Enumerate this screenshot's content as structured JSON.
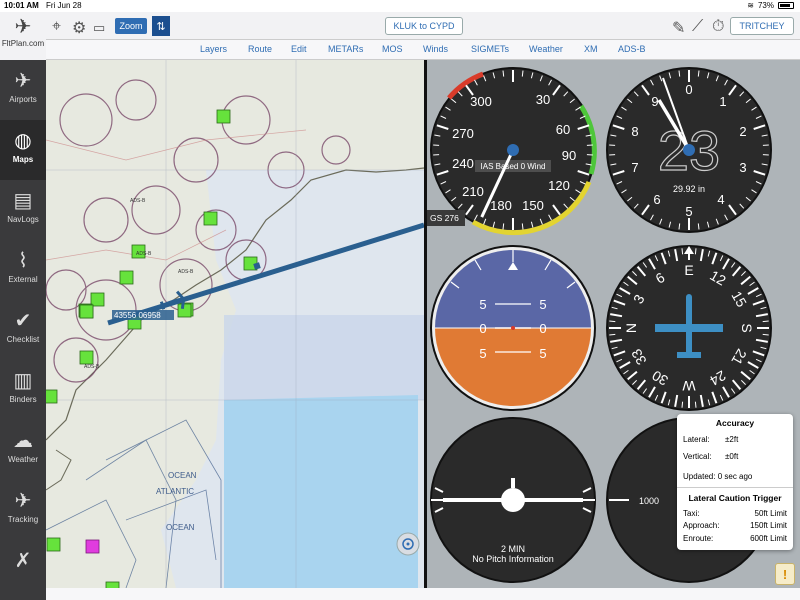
{
  "status": {
    "time": "10:01 AM",
    "date": "Fri Jun 28",
    "battery": "73%"
  },
  "toolbar": {
    "logo_text": "FltPlan.com",
    "zoom_label": "Zoom",
    "swap_label": "⇅",
    "route_label": "KLUK to CYPD",
    "user_label": "TRITCHEY"
  },
  "menu": [
    "Layers",
    "Route",
    "Edit",
    "METARs",
    "MOS",
    "Winds",
    "SIGMETs",
    "Weather",
    "XM",
    "ADS-B"
  ],
  "sidebar": [
    {
      "label": "Airports",
      "icon": "airport-icon"
    },
    {
      "label": "Maps",
      "icon": "globe-icon",
      "active": true
    },
    {
      "label": "NavLogs",
      "icon": "navlog-icon"
    },
    {
      "label": "External",
      "icon": "antenna-icon"
    },
    {
      "label": "Checklist",
      "icon": "check-icon"
    },
    {
      "label": "Binders",
      "icon": "binder-icon"
    },
    {
      "label": "Weather",
      "icon": "cloud-icon"
    },
    {
      "label": "Tracking",
      "icon": "plane-track-icon"
    },
    {
      "label": "",
      "icon": "tools-icon"
    }
  ],
  "map": {
    "ocean_label": "ATLANTIC",
    "ocean_label2": "OCEAN",
    "ocean_label3": "OCEAN",
    "aircraft_tag": "43556 06958",
    "gs_label": "GS 276",
    "adsb_labels": [
      "ADS-B",
      "ADS-B",
      "ADS-B",
      "ADS-B"
    ],
    "location_icon": "crosshair-icon"
  },
  "instruments": {
    "airspeed": {
      "ticks": [
        "300",
        "30",
        "60",
        "90",
        "120",
        "150",
        "180",
        "210",
        "240",
        "270"
      ],
      "label": "IAS Based 0 Wind",
      "value_deg": 205
    },
    "altimeter": {
      "ticks": [
        "0",
        "1",
        "2",
        "3",
        "4",
        "5",
        "6",
        "7",
        "8",
        "9"
      ],
      "big_value": "23",
      "setting": "29.92 in"
    },
    "attitude": {
      "pitch_labels": [
        "5",
        "5",
        "0",
        "0",
        "5",
        "5"
      ]
    },
    "heading": {
      "labels": [
        "E",
        "12",
        "15",
        "S",
        "21",
        "24",
        "W",
        "30",
        "33",
        "N",
        "3",
        "6"
      ]
    },
    "turn": {
      "label1": "2 MIN",
      "label2": "No Pitch Information"
    },
    "vsi": {
      "label": "1000"
    }
  },
  "accuracy": {
    "title": "Accuracy",
    "lateral_label": "Lateral:",
    "lateral_value": "±2ft",
    "vertical_label": "Vertical:",
    "vertical_value": "±0ft",
    "updated": "Updated: 0 sec ago",
    "caution_title": "Lateral Caution Trigger",
    "taxi_label": "Taxi:",
    "taxi_value": "50ft Limit",
    "approach_label": "Approach:",
    "approach_value": "150ft Limit",
    "enroute_label": "Enroute:",
    "enroute_value": "600ft Limit"
  },
  "colors": {
    "accent": "#2f6db3",
    "route": "#2a5f8f",
    "sky": "#5a67a6",
    "ground": "#e07a34",
    "airport": "#66e23c"
  }
}
